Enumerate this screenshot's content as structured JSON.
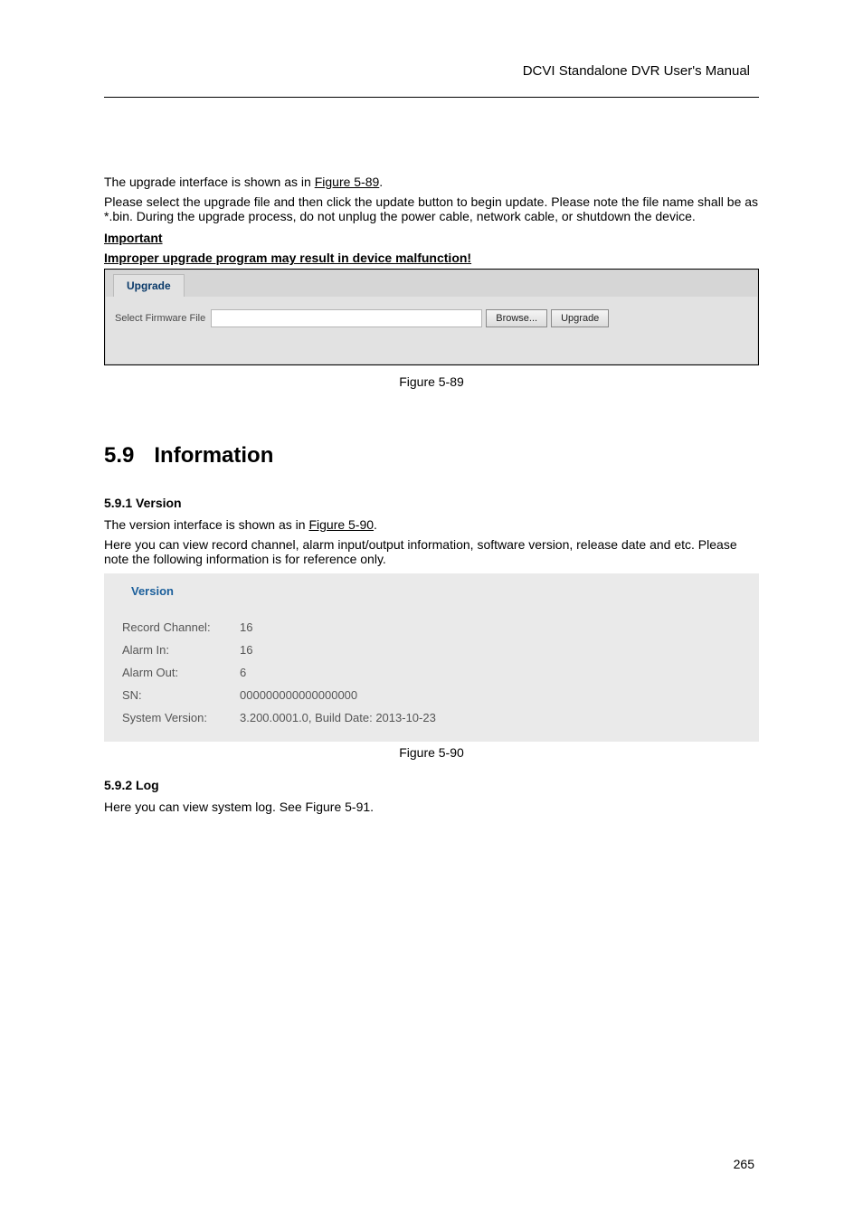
{
  "header": {
    "title": "DCVI Standalone DVR User's Manual"
  },
  "intro": {
    "line1": "The upgrade interface is shown as in ",
    "figref": "Figure 5-89",
    "line1_end": ".",
    "line2": "Please select the upgrade file and then click the update button to begin update. Please note the file name shall be as *.bin. During the upgrade process, do not unplug the power cable, network cable, or shutdown the device.",
    "important_label": "Important",
    "important_text": "Improper upgrade program may result in device malfunction!"
  },
  "upgradePanel": {
    "tab": "Upgrade",
    "label": "Select Firmware File",
    "browse": "Browse...",
    "upgrade": "Upgrade"
  },
  "figcap1": "Figure 5-89",
  "section": {
    "num": "5.9",
    "title": "Information"
  },
  "subsection": {
    "num": "5.9.1",
    "title": "Version"
  },
  "versionIntro": {
    "line1": "The version interface is shown as in ",
    "figref": "Figure 5-90",
    "line1_end": ".",
    "line2": "Here you can view record channel, alarm input/output information, software version, release date and etc. Please note the following information is for reference only."
  },
  "versionPanel": {
    "tab": "Version",
    "rows": [
      {
        "label": "Record Channel:",
        "value": "16"
      },
      {
        "label": "Alarm In:",
        "value": "16"
      },
      {
        "label": "Alarm Out:",
        "value": "6"
      },
      {
        "label": "SN:",
        "value": "000000000000000000"
      },
      {
        "label": "System Version:",
        "value": "3.200.0001.0, Build Date: 2013-10-23"
      }
    ]
  },
  "figcap2": "Figure 5-90",
  "sectionLog": {
    "num": "5.9.2",
    "title": "Log"
  },
  "logText": "Here you can view system log. See Figure 5-91.",
  "pageNumber": "265"
}
